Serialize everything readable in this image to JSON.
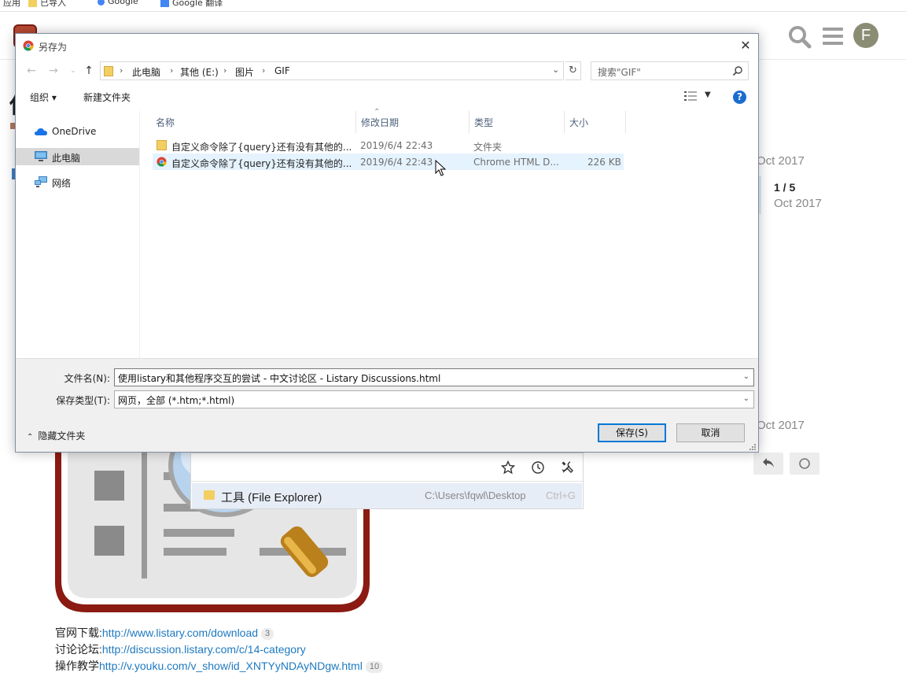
{
  "bookmarks": [
    {
      "label": "应用"
    },
    {
      "label": "已导入"
    },
    {
      "label": "Google"
    },
    {
      "label": "Google 翻译"
    }
  ],
  "header": {
    "avatar_letter": "F"
  },
  "timeline": {
    "date_top": "Oct 2017",
    "count": "1 / 5",
    "date_mid": "Oct 2017",
    "date_bottom": "Oct 2017"
  },
  "page": {
    "partial_title_char": "使"
  },
  "listary": {
    "result_name": "工具 (File Explorer)",
    "result_path": "C:\\Users\\fqwl\\Desktop",
    "result_shortcut": "Ctrl+G"
  },
  "links": [
    {
      "label": "官网下载:",
      "url": "http://www.listary.com/download",
      "count": "3"
    },
    {
      "label": "讨论论坛:",
      "url": "http://discussion.listary.com/c/14-category",
      "count": ""
    },
    {
      "label": "操作教学",
      "url": "http://v.youku.com/v_show/id_XNTYyNDAyNDgw.html",
      "count": "10"
    }
  ],
  "dialog": {
    "title": "另存为",
    "close": "✕",
    "breadcrumbs": [
      "此电脑",
      "其他 (E:)",
      "图片",
      "GIF"
    ],
    "search_placeholder": "搜索\"GIF\"",
    "toolbar": {
      "organize": "组织 ▾",
      "new_folder": "新建文件夹"
    },
    "nav_items": [
      {
        "label": "OneDrive",
        "icon": "onedrive-icon"
      },
      {
        "label": "此电脑",
        "icon": "computer-icon",
        "selected": true
      },
      {
        "label": "网络",
        "icon": "network-icon"
      }
    ],
    "columns": [
      "名称",
      "修改日期",
      "类型",
      "大小"
    ],
    "files": [
      {
        "name": "自定义命令除了{query}还有没有其他的...",
        "date": "2019/6/4 22:43",
        "type": "文件夹",
        "size": "",
        "icon": "folder-icon"
      },
      {
        "name": "自定义命令除了{query}还有没有其他的...",
        "date": "2019/6/4 22:43",
        "type": "Chrome HTML D...",
        "size": "226 KB",
        "icon": "chrome-icon",
        "selected": true
      }
    ],
    "filename_label": "文件名(N):",
    "filename_value": "使用listary和其他程序交互的尝试 - 中文讨论区 - Listary Discussions.html",
    "filetype_label": "保存类型(T):",
    "filetype_value": "网页，全部 (*.htm;*.html)",
    "hide_folders": "隐藏文件夹",
    "save_label": "保存(S)",
    "cancel_label": "取消"
  },
  "colors": {
    "accent": "#0078d7",
    "link": "#1e79c0",
    "selection": "#e5f3ff",
    "folder": "#f3cf62",
    "avatar": "#8b8c74"
  }
}
